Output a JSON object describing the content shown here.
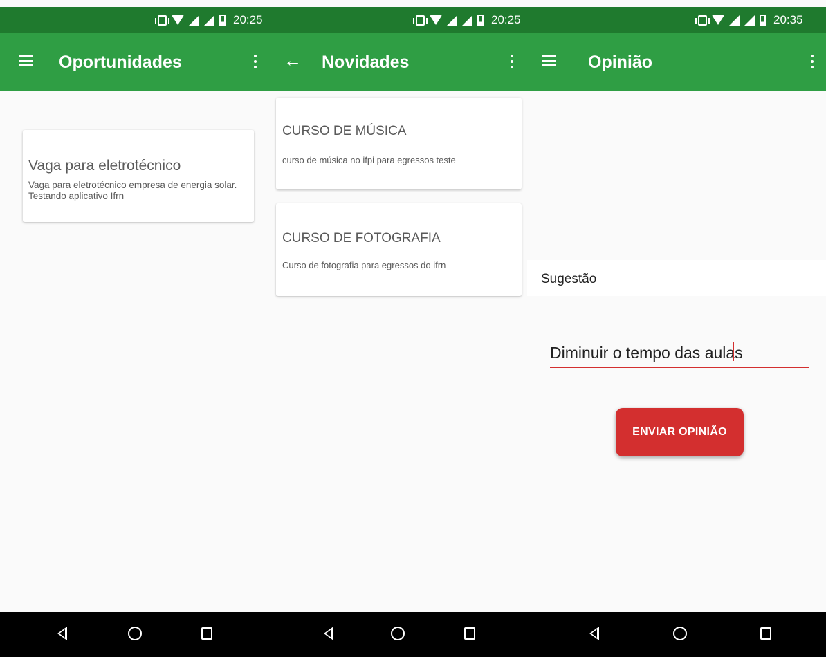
{
  "screens": [
    {
      "status": {
        "time": "20:25"
      },
      "appbar": {
        "title": "Oportunidades",
        "nav_icon": "menu-icon",
        "action_icon": "more-vert-icon"
      },
      "cards": [
        {
          "title": "Vaga para eletrotécnico",
          "text": "Vaga para eletrotécnico empresa de energia solar. Testando aplicativo Ifrn"
        }
      ]
    },
    {
      "status": {
        "time": "20:25"
      },
      "appbar": {
        "title": "Novidades",
        "nav_icon": "arrow-back-icon",
        "back_glyph": "←",
        "action_icon": "more-vert-icon"
      },
      "cards": [
        {
          "title": "CURSO DE MÚSICA",
          "text": "curso de música no ifpi para egressos teste"
        },
        {
          "title": "CURSO DE FOTOGRAFIA",
          "text": "Curso de fotografia para egressos do ifrn"
        }
      ]
    },
    {
      "status": {
        "time": "20:35"
      },
      "appbar": {
        "title": "Opinião",
        "nav_icon": "menu-icon",
        "action_icon": "more-vert-icon"
      },
      "form": {
        "label": "Sugestão",
        "input_value": "Diminuir o tempo das aulas",
        "submit_label": "ENVIAR OPINIÃO"
      }
    }
  ],
  "colors": {
    "status_bar": "#1f7a2e",
    "app_bar": "#2f9e44",
    "accent": "#d32f2f",
    "nav_bar": "#000000"
  }
}
